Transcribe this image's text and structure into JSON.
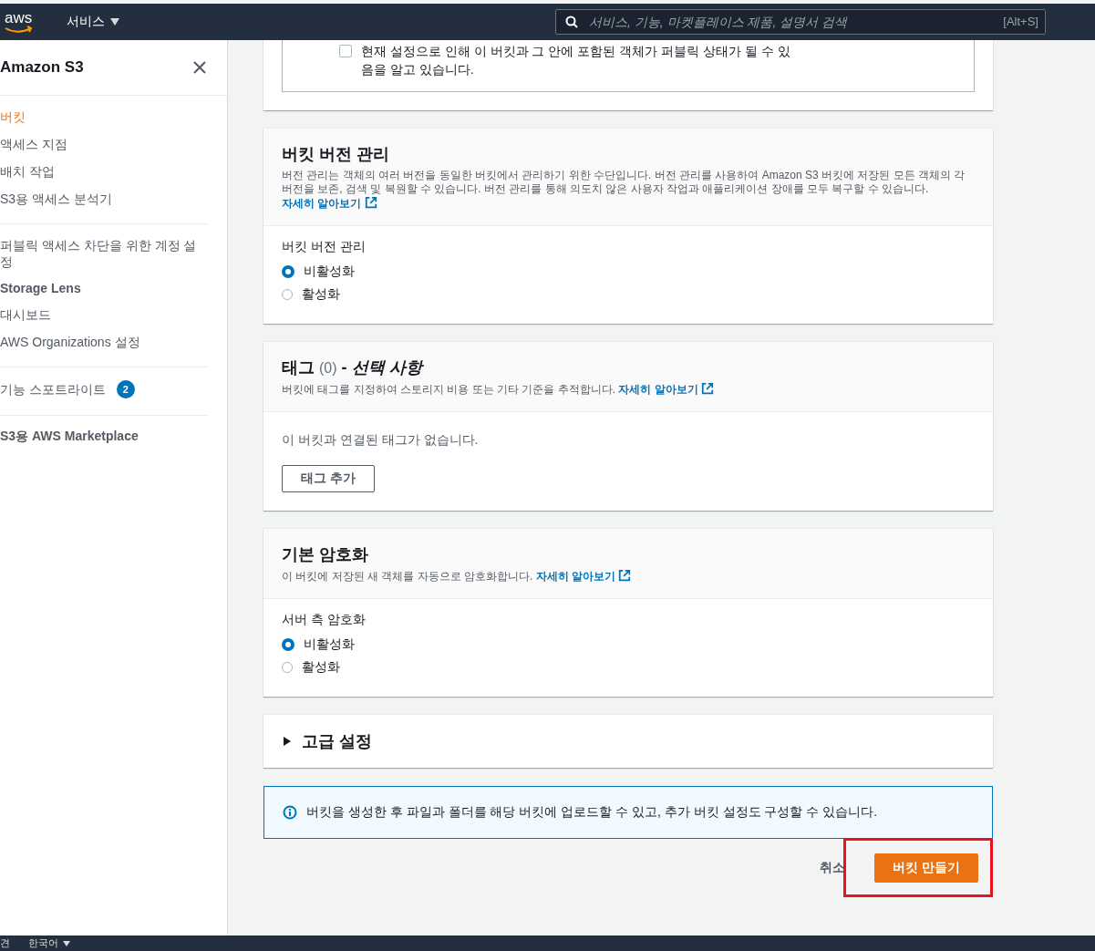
{
  "topbar": {
    "logo_text": "aws",
    "services_label": "서비스",
    "search": {
      "placeholder": "서비스, 기능, 마켓플레이스 제품, 설명서 검색",
      "shortcut": "[Alt+S]"
    }
  },
  "sidebar": {
    "title": "Amazon S3",
    "groups": [
      {
        "items": [
          {
            "kind": "link",
            "label": "버킷",
            "selected": true
          },
          {
            "kind": "link",
            "label": "액세스 지점",
            "selected": false
          },
          {
            "kind": "link",
            "label": "배치 작업",
            "selected": false
          },
          {
            "kind": "link",
            "label": "S3용 액세스 분석기",
            "selected": false
          }
        ]
      },
      {
        "items": [
          {
            "kind": "link",
            "label": "퍼블릭 액세스 차단을 위한 계정 설정",
            "selected": false
          },
          {
            "kind": "heading",
            "label": "Storage Lens"
          },
          {
            "kind": "link",
            "label": "대시보드",
            "selected": false
          },
          {
            "kind": "link",
            "label": "AWS Organizations 설정",
            "selected": false
          }
        ]
      },
      {
        "items": [
          {
            "kind": "link",
            "label": "기능 스포트라이트",
            "selected": false,
            "badge": "2"
          }
        ]
      },
      {
        "items": [
          {
            "kind": "heading",
            "label": "S3용 AWS Marketplace"
          }
        ]
      }
    ]
  },
  "public_access_ack": {
    "label": "현재 설정으로 인해 이 버킷과 그 안에 포함된 객체가 퍼블릭 상태가 될 수 있음을 알고 있습니다.",
    "checked": false
  },
  "sections": [
    {
      "kind": "radio",
      "title": "버킷 버전 관리",
      "description": "버전 관리는 객체의 여러 버전을 동일한 버킷에서 관리하기 위한 수단입니다. 버전 관리를 사용하여 Amazon S3 버킷에 저장된 모든 객체의 각 버전을 보존, 검색 및 복원할 수 있습니다. 버전 관리를 통해 의도치 않은 사용자 작업과 애플리케이션 장애를 모두 복구할 수 있습니다.",
      "learn_more": "자세히 알아보기",
      "field_label": "버킷 버전 관리",
      "options": [
        {
          "label": "비활성화",
          "selected": true
        },
        {
          "label": "활성화",
          "selected": false
        }
      ]
    },
    {
      "kind": "tags",
      "title": "태그",
      "count": "(0)",
      "qualifier": "- *선택 사항*",
      "description": "버킷에 태그를 지정하여 스토리지 비용 또는 기타 기준을 추적합니다.",
      "learn_more": "자세히 알아보기",
      "empty_text": "이 버킷과 연결된 태그가 없습니다.",
      "button": "태그 추가"
    },
    {
      "kind": "radio",
      "title": "기본 암호화",
      "description": "이 버킷에 저장된 새 객체를 자동으로 암호화합니다.",
      "learn_more": "자세히 알아보기",
      "field_label": "서버 측 암호화",
      "options": [
        {
          "label": "비활성화",
          "selected": true
        },
        {
          "label": "활성화",
          "selected": false
        }
      ]
    },
    {
      "kind": "collapsible",
      "title": "고급 설정",
      "expanded": false
    }
  ],
  "info_alert": {
    "text": "버킷을 생성한 후 파일과 폴더를 해당 버킷에 업로드할 수 있고, 추가 버킷 설정도 구성할 수 있습니다."
  },
  "actions": {
    "cancel": "취소",
    "create": {
      "label": "버킷 만들기",
      "highlighted": true
    }
  },
  "footer": {
    "feedback_fragment": "견",
    "language": "한국어"
  }
}
